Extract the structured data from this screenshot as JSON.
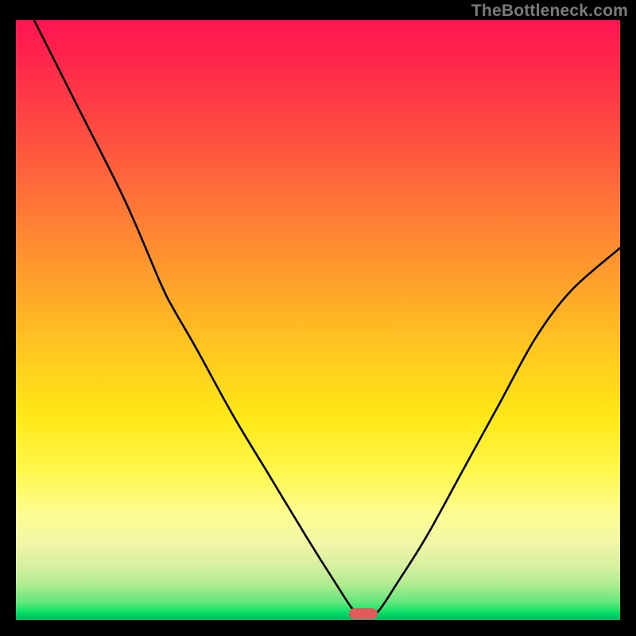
{
  "watermark": "TheBottleneck.com",
  "marker": {
    "x_pct": 57.5,
    "y_pct": 99.0,
    "color": "#e35a5a"
  },
  "chart_data": {
    "type": "line",
    "title": "",
    "xlabel": "",
    "ylabel": "",
    "xlim": [
      0,
      100
    ],
    "ylim": [
      0,
      100
    ],
    "grid": false,
    "series": [
      {
        "name": "curve",
        "x": [
          3,
          10,
          18,
          24,
          26,
          30,
          36,
          42,
          48,
          53,
          56,
          58,
          60,
          63,
          68,
          74,
          80,
          86,
          92,
          100
        ],
        "y": [
          100,
          86,
          70,
          56,
          52,
          45,
          34,
          24,
          14,
          6,
          1.5,
          0.5,
          1.5,
          6,
          14,
          25,
          36,
          47,
          55,
          62
        ]
      }
    ],
    "annotations": [
      {
        "type": "marker-pill",
        "x": 57.5,
        "y": 1.0,
        "color": "#e35a5a"
      }
    ]
  }
}
